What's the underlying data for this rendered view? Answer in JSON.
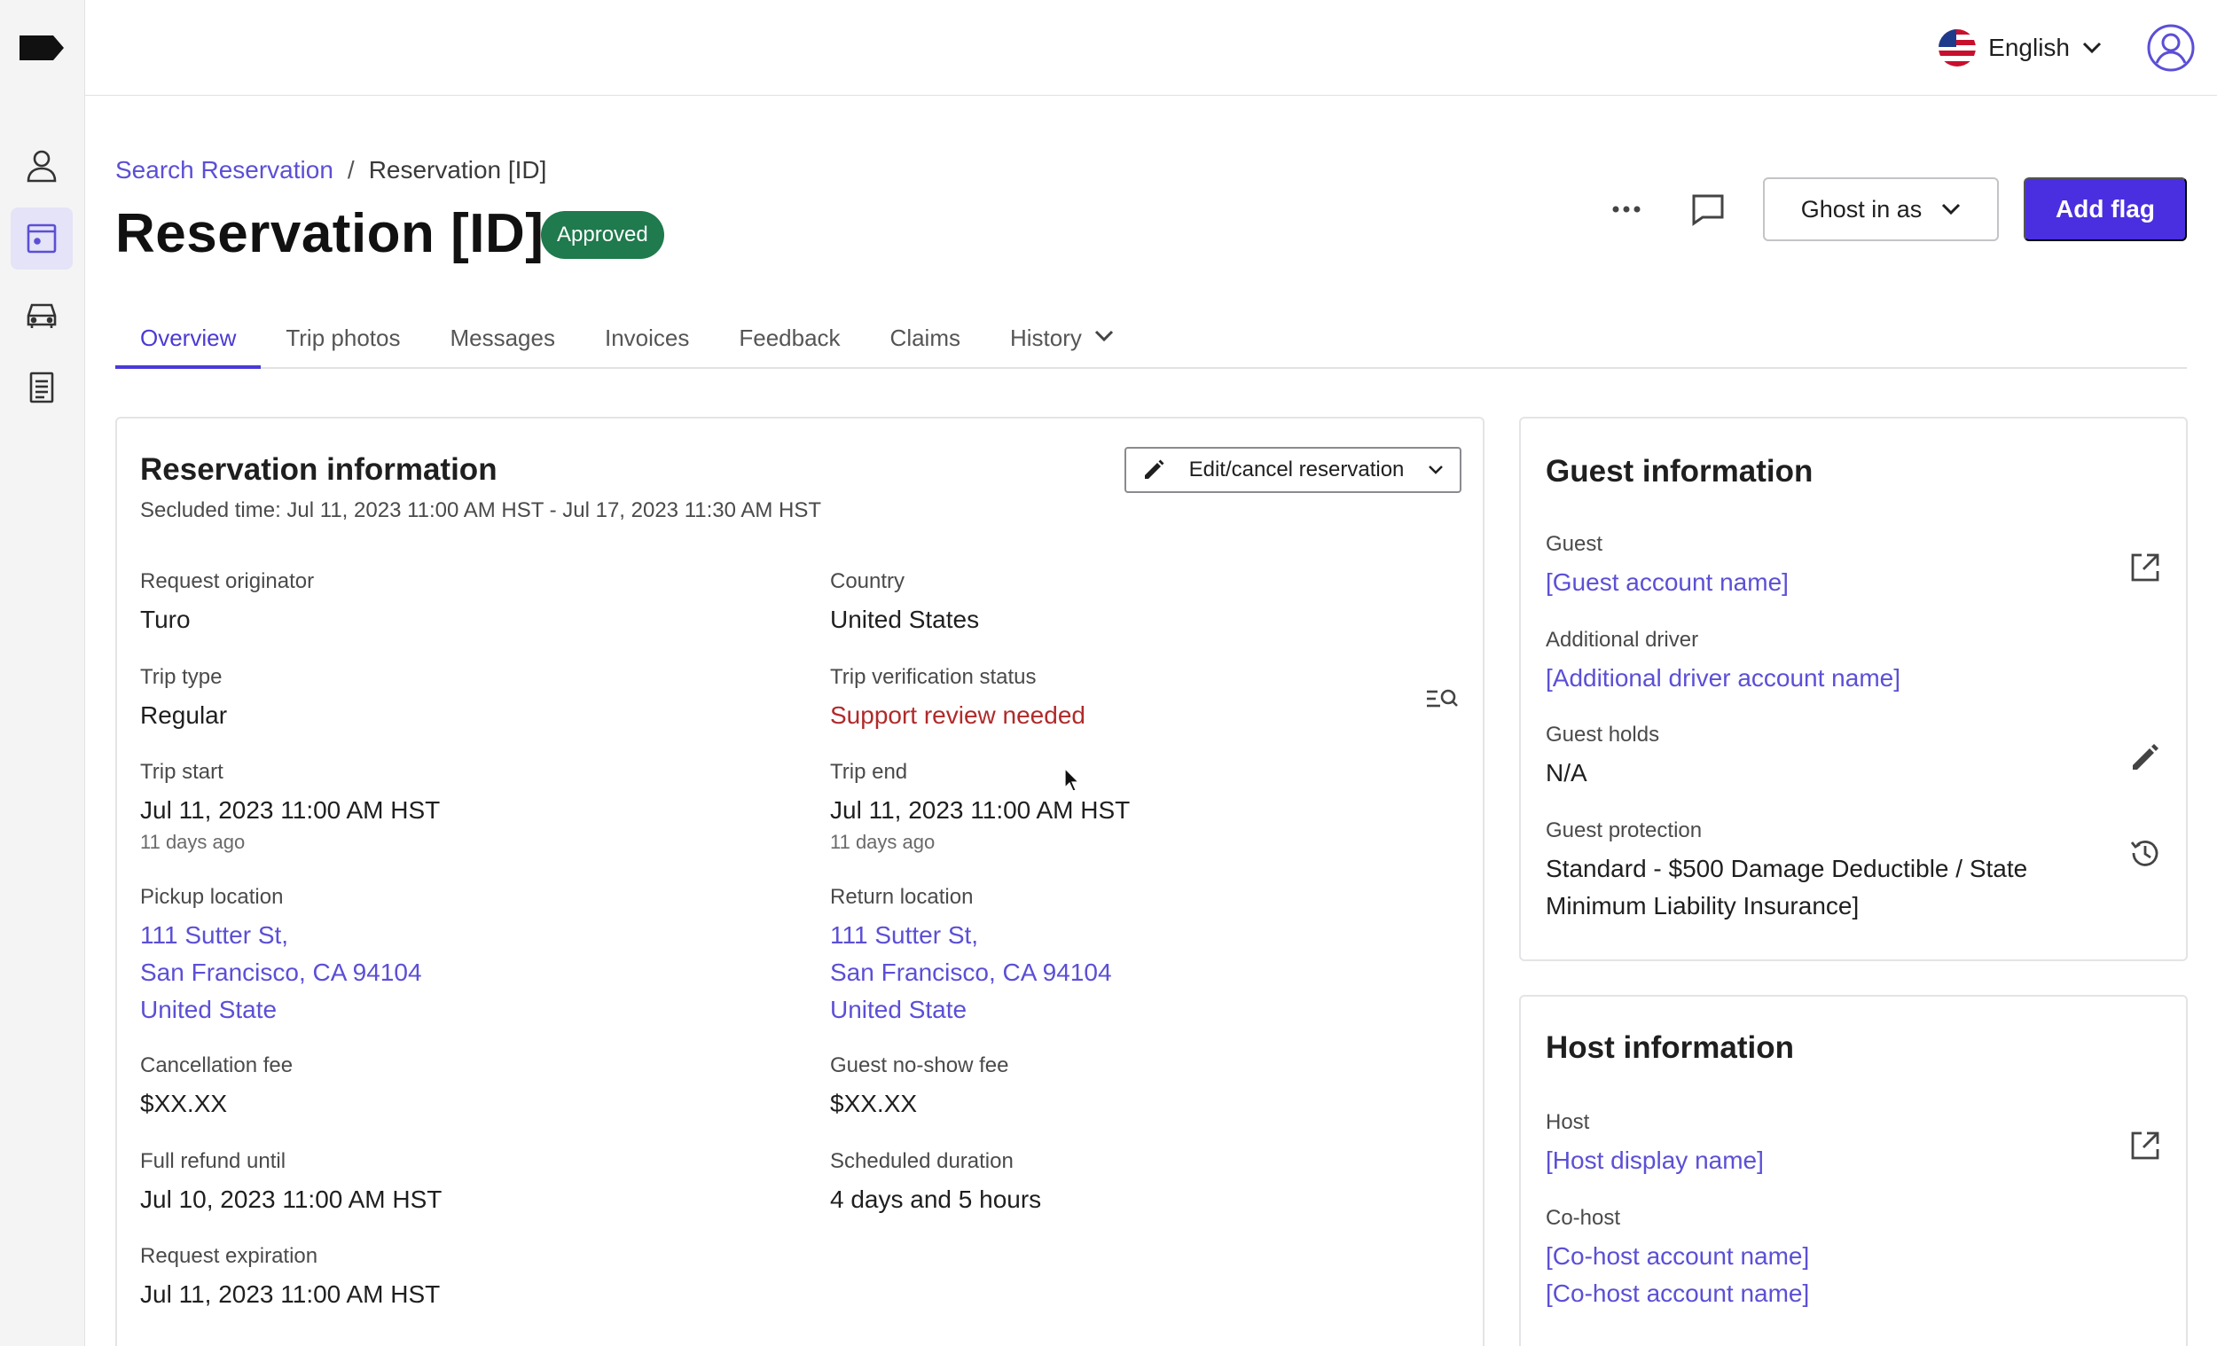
{
  "sidebar": {
    "items": [
      {
        "icon": "person-icon"
      },
      {
        "icon": "reservation-icon",
        "active": true
      },
      {
        "icon": "car-icon"
      },
      {
        "icon": "document-icon"
      }
    ]
  },
  "topbar": {
    "language": "English"
  },
  "breadcrumb": {
    "parent": "Search Reservation",
    "separator": "/",
    "current": "Reservation [ID]"
  },
  "header": {
    "title": "Reservation [ID]",
    "status": "Approved",
    "ghost_label": "Ghost in as",
    "add_flag_label": "Add flag"
  },
  "tabs": [
    "Overview",
    "Trip photos",
    "Messages",
    "Invoices",
    "Feedback",
    "Claims",
    "History"
  ],
  "reservation": {
    "title": "Reservation information",
    "scheduled_time": "Secluded time: Jul 11, 2023 11:00 AM HST - Jul 17, 2023 11:30 AM HST",
    "edit_label": "Edit/cancel reservation",
    "request_originator": {
      "label": "Request originator",
      "value": "Turo"
    },
    "country": {
      "label": "Country",
      "value": "United States"
    },
    "trip_type": {
      "label": "Trip type",
      "value": "Regular"
    },
    "verification": {
      "label": "Trip verification status",
      "value": "Support review needed"
    },
    "trip_start": {
      "label": "Trip start",
      "value": "Jul 11, 2023 11:00 AM HST",
      "meta": "11 days ago"
    },
    "trip_end": {
      "label": "Trip end",
      "value": "Jul 11, 2023 11:00 AM HST",
      "meta": "11 days ago"
    },
    "pickup": {
      "label": "Pickup location",
      "line1": "111 Sutter St,",
      "line2": "San Francisco, CA 94104",
      "line3": "United State"
    },
    "return": {
      "label": "Return location",
      "line1": "111 Sutter St,",
      "line2": "San Francisco, CA 94104",
      "line3": "United State"
    },
    "cancellation_fee": {
      "label": "Cancellation fee",
      "value": "$XX.XX"
    },
    "no_show_fee": {
      "label": "Guest no-show fee",
      "value": "$XX.XX"
    },
    "full_refund": {
      "label": "Full refund until",
      "value": "Jul 10, 2023 11:00 AM HST"
    },
    "duration": {
      "label": "Scheduled duration",
      "value": "4 days and 5 hours"
    },
    "request_expiration": {
      "label": "Request expiration",
      "value": "Jul 11, 2023 11:00 AM HST"
    }
  },
  "guest": {
    "title": "Guest information",
    "guest": {
      "label": "Guest",
      "value": "[Guest account name]"
    },
    "additional_driver": {
      "label": "Additional driver",
      "value": "[Additional driver account name]"
    },
    "holds": {
      "label": "Guest holds",
      "value": "N/A"
    },
    "protection": {
      "label": "Guest protection",
      "value1": "Standard - $500 Damage Deductible / State",
      "value2": "Minimum Liability Insurance]"
    }
  },
  "host": {
    "title": "Host information",
    "host": {
      "label": "Host",
      "value": "[Host display name]"
    },
    "cohost": {
      "label": "Co-host",
      "value1": "[Co-host account name]",
      "value2": "[Co-host account name]"
    }
  },
  "colors": {
    "accent": "#4a2fe0",
    "link": "#5b4fd6",
    "approved": "#1f7a4d",
    "alert": "#b02a2a"
  }
}
